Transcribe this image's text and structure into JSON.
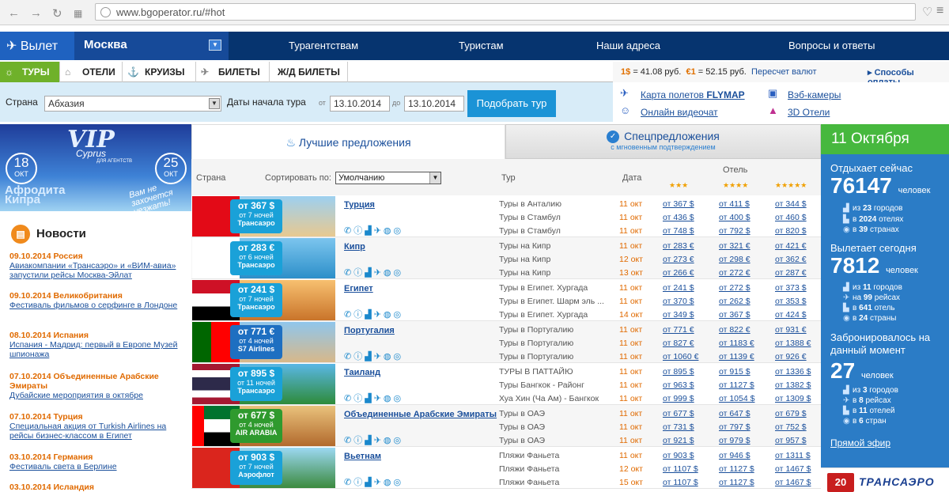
{
  "browser": {
    "url": "www.bgoperator.ru/#hot"
  },
  "nav": {
    "depart": "Вылет",
    "city": "Москва",
    "items": [
      "Турагентствам",
      "Туристам",
      "Наши адреса",
      "Вопросы и ответы"
    ]
  },
  "tabs": [
    "ТУРЫ",
    "ОТЕЛИ",
    "КРУИЗЫ",
    "БИЛЕТЫ",
    "Ж/Д БИЛЕТЫ"
  ],
  "rates": {
    "usd": "1$",
    "usd_val": "= 41.08 руб.",
    "eur": "€1",
    "eur_val": "= 52.15 руб.",
    "recalc": "Пересчет валют",
    "payment": "Способы оплаты"
  },
  "search": {
    "country_label": "Страна",
    "country": "Абхазия",
    "dates_label": "Даты начала тура",
    "from": "от",
    "date_from": "13.10.2014",
    "to": "до",
    "date_to": "13.10.2014",
    "button": "Подобрать тур"
  },
  "links": {
    "map": "Карта полетов",
    "map_brand": "FLYMAP",
    "video": "Онлайн видеочат",
    "webcams": "Вэб-камеры",
    "hotels3d": "3D Отели"
  },
  "vip": {
    "title": "VIP",
    "sub": "Cyprus",
    "agents": "ДЛЯ АГЕНТСТВ",
    "d1": "18",
    "d2": "25",
    "month": "ОКТ",
    "name1": "Афродита",
    "name2": "Кипра",
    "slogan": "Вам не захочется уезжать!"
  },
  "news": {
    "title": "Новости",
    "items": [
      {
        "date": "09.10.2014",
        "country": "Россия",
        "text": "Авиакомпании «Трансаэро» и «ВИМ-авиа» запустили рейсы Москва-Эйлат"
      },
      {
        "date": "09.10.2014",
        "country": "Великобритания",
        "text": "Фестиваль фильмов о серфинге в Лондоне"
      },
      {
        "date": "08.10.2014",
        "country": "Испания",
        "text": "Испания - Мадрид: первый в Европе Музей шпионажа"
      },
      {
        "date": "07.10.2014",
        "country": "Объединенные Арабские Эмираты",
        "text": "Дубайские мероприятия в октябре"
      },
      {
        "date": "07.10.2014",
        "country": "Турция",
        "text": "Специальная акция от Turkish Airlines на рейсы бизнес-классом в Египет"
      },
      {
        "date": "03.10.2014",
        "country": "Германия",
        "text": "Фестиваль света в Берлине"
      },
      {
        "date": "03.10.2014",
        "country": "Исландия",
        "text": ""
      }
    ]
  },
  "offers": {
    "tab_best": "Лучшие предложения",
    "tab_special": "Спецпредложения",
    "tab_special_sub": "с мгновенным подтверждением",
    "h_country": "Страна",
    "h_sort": "Сортировать по:",
    "sort_value": "Умолчанию",
    "h_tour": "Тур",
    "h_date": "Дата",
    "h_hotel": "Отель",
    "stars": [
      "★★★",
      "★★★★",
      "★★★★★"
    ],
    "rows": [
      {
        "country": "Турция",
        "price": "от 367 $",
        "nights": "от 7 ночей",
        "carrier": "Трансаэро",
        "tours": [
          "Туры в Анталию",
          "Туры в Стамбул",
          "Туры в Стамбул"
        ],
        "dates": [
          "11 окт",
          "11 окт",
          "11 окт"
        ],
        "p3": [
          "от 367 $",
          "от 436 $",
          "от 748 $"
        ],
        "p4": [
          "от 411 $",
          "от 400 $",
          "от 792 $"
        ],
        "p5": [
          "от 344 $",
          "от 460 $",
          "от 820 $"
        ]
      },
      {
        "country": "Кипр",
        "price": "от 283 €",
        "nights": "от 6 ночей",
        "carrier": "Трансаэро",
        "tours": [
          "Туры на Кипр",
          "Туры на Кипр",
          "Туры на Кипр"
        ],
        "dates": [
          "11 окт",
          "12 окт",
          "13 окт"
        ],
        "p3": [
          "от 283 €",
          "от 273 €",
          "от 266 €"
        ],
        "p4": [
          "от 321 €",
          "от 298 €",
          "от 272 €"
        ],
        "p5": [
          "от 421 €",
          "от 362 €",
          "от 287 €"
        ]
      },
      {
        "country": "Египет",
        "price": "от 241 $",
        "nights": "от 7 ночей",
        "carrier": "Трансаэро",
        "tours": [
          "Туры в Египет. Хургада",
          "Туры в Египет. Шарм эль ...",
          "Туры в Египет. Хургада"
        ],
        "dates": [
          "11 окт",
          "11 окт",
          "14 окт"
        ],
        "p3": [
          "от 241 $",
          "от 370 $",
          "от 349 $"
        ],
        "p4": [
          "от 272 $",
          "от 262 $",
          "от 367 $"
        ],
        "p5": [
          "от 373 $",
          "от 353 $",
          "от 424 $"
        ]
      },
      {
        "country": "Португалия",
        "price": "от 771 €",
        "nights": "от 4 ночей",
        "carrier": "S7 Airlines",
        "tours": [
          "Туры в Португалию",
          "Туры в Португалию",
          "Туры в Португалию"
        ],
        "dates": [
          "11 окт",
          "11 окт",
          "11 окт"
        ],
        "p3": [
          "от 771 €",
          "от 827 €",
          "от 1060 €"
        ],
        "p4": [
          "от 822 €",
          "от 1183 €",
          "от 1139 €"
        ],
        "p5": [
          "от 931 €",
          "от 1388 €",
          "от 926 €"
        ]
      },
      {
        "country": "Таиланд",
        "price": "от 895 $",
        "nights": "от 11 ночей",
        "carrier": "Трансаэро",
        "tours": [
          "ТУРЫ В ПАТТАЙЮ",
          "Туры Бангкок - Районг",
          "Хуа Хин (Ча Ам) - Бангкок"
        ],
        "dates": [
          "11 окт",
          "11 окт",
          "11 окт"
        ],
        "p3": [
          "от 895 $",
          "от 963 $",
          "от 999 $"
        ],
        "p4": [
          "от 915 $",
          "от 1127 $",
          "от 1054 $"
        ],
        "p5": [
          "от 1336 $",
          "от 1382 $",
          "от 1309 $"
        ]
      },
      {
        "country": "Объединенные Арабские Эмираты",
        "price": "от 677 $",
        "nights": "от 4 ночей",
        "carrier": "AIR ARABIA",
        "tours": [
          "Туры в ОАЭ",
          "Туры в ОАЭ",
          "Туры в ОАЭ"
        ],
        "dates": [
          "11 окт",
          "11 окт",
          "11 окт"
        ],
        "p3": [
          "от 677 $",
          "от 731 $",
          "от 921 $"
        ],
        "p4": [
          "от 647 $",
          "от 797 $",
          "от 979 $"
        ],
        "p5": [
          "от 679 $",
          "от 752 $",
          "от 957 $"
        ]
      },
      {
        "country": "Вьетнам",
        "price": "от 903 $",
        "nights": "от 7 ночей",
        "carrier": "Аэрофлот",
        "tours": [
          "Пляжи Фаньета",
          "Пляжи Фаньета",
          "Пляжи Фаньета"
        ],
        "dates": [
          "11 окт",
          "12 окт",
          "15 окт"
        ],
        "p3": [
          "от 903 $",
          "от 1107 $",
          "от 1107 $"
        ],
        "p4": [
          "от 946 $",
          "от 1127 $",
          "от 1127 $"
        ],
        "p5": [
          "от 1311 $",
          "от 1467 $",
          "от 1467 $"
        ]
      }
    ]
  },
  "side": {
    "date": "11 Октября",
    "rest_label": "Отдыхает сейчас",
    "rest_num": "76147",
    "people": "человек",
    "rest_l1": [
      "из",
      "23",
      "городов"
    ],
    "rest_l2": [
      "в",
      "2024",
      "отелях"
    ],
    "rest_l3": [
      "в",
      "39",
      "странах"
    ],
    "fly_label": "Вылетает сегодня",
    "fly_num": "7812",
    "fly_l1": [
      "из",
      "11",
      "городов"
    ],
    "fly_l2": [
      "на",
      "99",
      "рейсах"
    ],
    "fly_l3": [
      "в",
      "641",
      "отель"
    ],
    "fly_l4": [
      "в",
      "24",
      "страны"
    ],
    "book_label": "Забронировалось на данный момент",
    "book_num": "27",
    "book_l1": [
      "из",
      "3",
      "городов"
    ],
    "book_l2": [
      "в",
      "8",
      "рейсах"
    ],
    "book_l3": [
      "в",
      "11",
      "отелей"
    ],
    "book_l4": [
      "в",
      "6",
      "стран"
    ],
    "ether": "Прямой эфир"
  },
  "transaero": {
    "num": "20",
    "name": "ТРАНСАЭРО"
  }
}
